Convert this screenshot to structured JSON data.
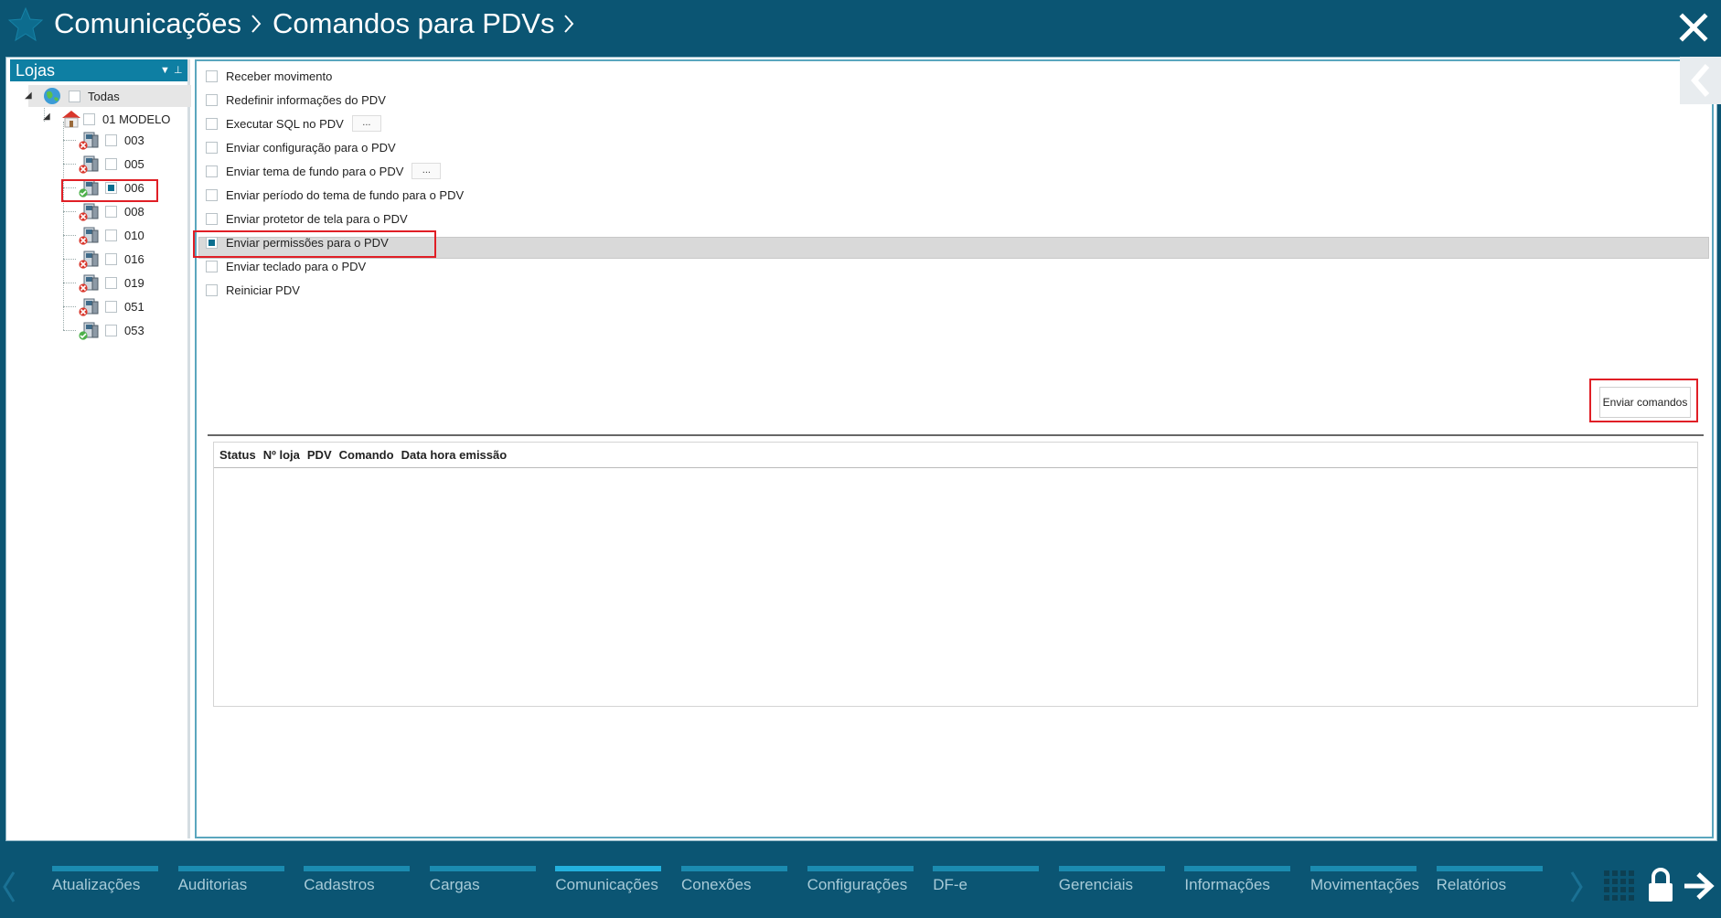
{
  "header": {
    "breadcrumb": [
      "Comunicações",
      "Comandos para PDVs"
    ]
  },
  "left_panel": {
    "title": "Lojas",
    "root": {
      "label": "Todas",
      "checked": false
    },
    "store": {
      "label": "01 MODELO",
      "checked": false
    },
    "pdvs": [
      {
        "label": "003",
        "status": "offline",
        "checked": false
      },
      {
        "label": "005",
        "status": "offline",
        "checked": false
      },
      {
        "label": "006",
        "status": "online",
        "checked": true
      },
      {
        "label": "008",
        "status": "offline",
        "checked": false
      },
      {
        "label": "010",
        "status": "offline",
        "checked": false
      },
      {
        "label": "016",
        "status": "offline",
        "checked": false
      },
      {
        "label": "019",
        "status": "offline",
        "checked": false
      },
      {
        "label": "051",
        "status": "offline",
        "checked": false
      },
      {
        "label": "053",
        "status": "online",
        "checked": false
      }
    ]
  },
  "commands": [
    {
      "label": "Receber movimento",
      "checked": false,
      "has_options": false
    },
    {
      "label": "Redefinir informações do PDV",
      "checked": false,
      "has_options": false
    },
    {
      "label": "Executar SQL no PDV",
      "checked": false,
      "has_options": true
    },
    {
      "label": "Enviar configuração para o PDV",
      "checked": false,
      "has_options": false
    },
    {
      "label": "Enviar tema de fundo para o PDV",
      "checked": false,
      "has_options": true
    },
    {
      "label": "Enviar período do tema de fundo para o PDV",
      "checked": false,
      "has_options": false
    },
    {
      "label": "Enviar protetor de tela para o PDV",
      "checked": false,
      "has_options": false
    },
    {
      "label": "Enviar permissões para o PDV",
      "checked": true,
      "has_options": false
    },
    {
      "label": "Enviar teclado para o PDV",
      "checked": false,
      "has_options": false
    },
    {
      "label": "Reiniciar PDV",
      "checked": false,
      "has_options": false
    }
  ],
  "options_button_label": "...",
  "send_button_label": "Enviar comandos",
  "grid": {
    "columns": [
      "Status",
      "Nº loja",
      "PDV",
      "Comando",
      "Data hora emissão"
    ],
    "rows": []
  },
  "bottom_nav": {
    "items": [
      "Atualizações",
      "Auditorias",
      "Cadastros",
      "Cargas",
      "Comunicações",
      "Conexões",
      "Configurações",
      "DF-e",
      "Gerenciais",
      "Informações",
      "Movimentações",
      "Relatórios"
    ],
    "active": "Comunicações"
  },
  "colors": {
    "header_bg": "#0b5573",
    "accent": "#0e7fa3",
    "nav_bar_active": "#23b1de",
    "annotation_red": "#e01f26"
  },
  "icons": {
    "header": "star-icon",
    "close": "close-icon",
    "collapse": "chevron-left-icon",
    "root": "globe-icon",
    "store": "store-house-icon",
    "pdv": "pdv-terminal-icon",
    "bottom_right": [
      "grid-menu-icon",
      "lock-icon",
      "arrow-right-icon"
    ]
  }
}
